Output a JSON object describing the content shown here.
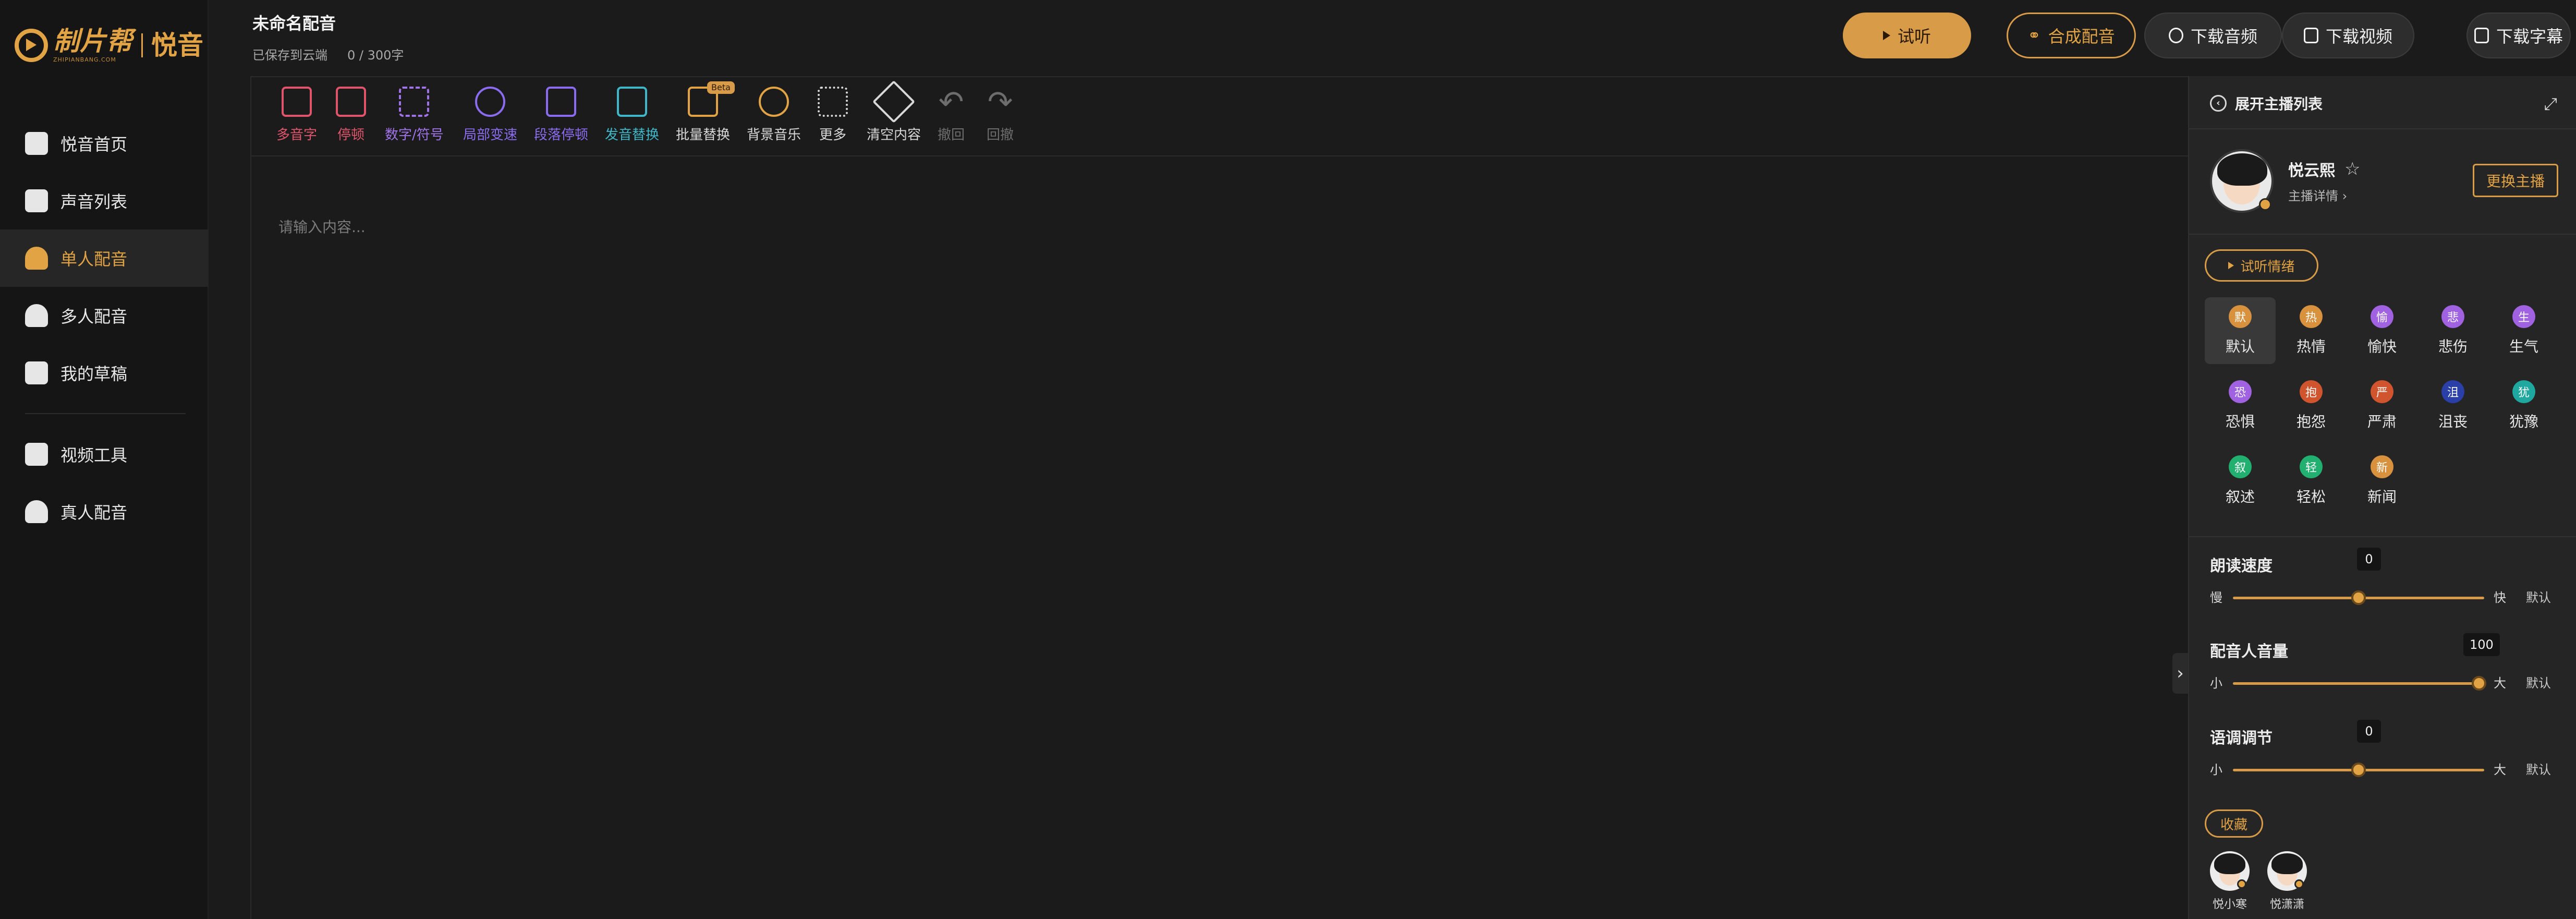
{
  "brand": {
    "logo_text": "制片帮",
    "logo_sub": "ZHIPIANBANG.COM",
    "product": "悦音"
  },
  "sidebar": {
    "items": [
      {
        "label": "悦音首页",
        "icon": "music-note-icon",
        "active": false
      },
      {
        "label": "声音列表",
        "icon": "list-icon",
        "active": false
      },
      {
        "label": "单人配音",
        "icon": "single-person-icon",
        "active": true
      },
      {
        "label": "多人配音",
        "icon": "multi-person-icon",
        "active": false
      },
      {
        "label": "我的草稿",
        "icon": "draft-icon",
        "active": false
      }
    ],
    "secondary_items": [
      {
        "label": "视频工具",
        "icon": "video-tool-icon"
      },
      {
        "label": "真人配音",
        "icon": "real-person-icon"
      }
    ]
  },
  "header": {
    "title": "未命名配音",
    "save_status": "已保存到云端",
    "char_count": "0 / 300字",
    "buttons": {
      "preview": "试听",
      "synthesize": "合成配音",
      "download_audio": "下载音频",
      "download_video": "下载视频",
      "download_subtitle": "下载字幕"
    }
  },
  "toolbar": {
    "items": [
      {
        "label": "多音字",
        "icon": "polyphone-icon",
        "color": "#e0556b",
        "disabled": false
      },
      {
        "label": "停顿",
        "icon": "pause-icon",
        "color": "#e0556b",
        "disabled": false
      },
      {
        "label": "数字/符号",
        "icon": "hash-icon",
        "color": "#a073e8",
        "disabled": false
      },
      {
        "label": "局部变速",
        "icon": "speed-icon",
        "color": "#8b6cf0",
        "disabled": false
      },
      {
        "label": "段落停顿",
        "icon": "paragraph-pause-icon",
        "color": "#8b6cf0",
        "disabled": false
      },
      {
        "label": "发音替换",
        "icon": "replace-icon",
        "color": "#3fb7c8",
        "disabled": false
      },
      {
        "label": "批量替换",
        "icon": "batch-replace-icon",
        "color": "#e2a344",
        "disabled": false,
        "badge": "Beta"
      },
      {
        "label": "背景音乐",
        "icon": "music-icon",
        "color": "#e2a344",
        "disabled": false
      },
      {
        "label": "更多",
        "icon": "more-grid-icon",
        "color": "#d8d8d8",
        "disabled": false
      },
      {
        "label": "清空内容",
        "icon": "broom-icon",
        "color": "#d8d8d8",
        "disabled": false
      },
      {
        "label": "撤回",
        "icon": "undo-icon",
        "color": "#6d6d6d",
        "disabled": true
      },
      {
        "label": "回撤",
        "icon": "redo-icon",
        "color": "#6d6d6d",
        "disabled": true
      }
    ]
  },
  "editor": {
    "placeholder": "请输入内容..."
  },
  "panel": {
    "title": "展开主播列表",
    "anchor": {
      "name": "悦云熙",
      "detail": "主播详情",
      "change_label": "更换主播"
    },
    "emotion_button": "试听情绪",
    "emotions": [
      {
        "label": "默认",
        "glyph": "默",
        "color": "#d8913d",
        "active": true
      },
      {
        "label": "热情",
        "glyph": "热",
        "color": "#d8913d",
        "active": false
      },
      {
        "label": "愉快",
        "glyph": "愉",
        "color": "#a062e0",
        "active": false
      },
      {
        "label": "悲伤",
        "glyph": "悲",
        "color": "#a062e0",
        "active": false
      },
      {
        "label": "生气",
        "glyph": "生",
        "color": "#a062e0",
        "active": false
      },
      {
        "label": "恐惧",
        "glyph": "恐",
        "color": "#a062e0",
        "active": false
      },
      {
        "label": "抱怨",
        "glyph": "抱",
        "color": "#d0552e",
        "active": false
      },
      {
        "label": "严肃",
        "glyph": "严",
        "color": "#d0552e",
        "active": false
      },
      {
        "label": "沮丧",
        "glyph": "沮",
        "color": "#2a3fa8",
        "active": false
      },
      {
        "label": "犹豫",
        "glyph": "犹",
        "color": "#1fa8a0",
        "active": false
      },
      {
        "label": "叙述",
        "glyph": "叙",
        "color": "#22b070",
        "active": false
      },
      {
        "label": "轻松",
        "glyph": "轻",
        "color": "#22b070",
        "active": false
      },
      {
        "label": "新闻",
        "glyph": "新",
        "color": "#d8913d",
        "active": false
      }
    ],
    "sliders": [
      {
        "label": "朗读速度",
        "value": "0",
        "min_label": "慢",
        "max_label": "快",
        "default_label": "默认",
        "fraction": 0.5
      },
      {
        "label": "配音人音量",
        "value": "100",
        "min_label": "小",
        "max_label": "大",
        "default_label": "默认",
        "fraction": 0.98
      },
      {
        "label": "语调调节",
        "value": "0",
        "min_label": "小",
        "max_label": "大",
        "default_label": "默认",
        "fraction": 0.5
      }
    ],
    "favorites_label": "收藏",
    "favorites": [
      {
        "name": "悦小寒"
      },
      {
        "name": "悦潇潇"
      }
    ]
  },
  "colors": {
    "accent": "#e2a344",
    "background": "#1b1b1b",
    "sidebar": "#151515",
    "panel": "#252525"
  }
}
